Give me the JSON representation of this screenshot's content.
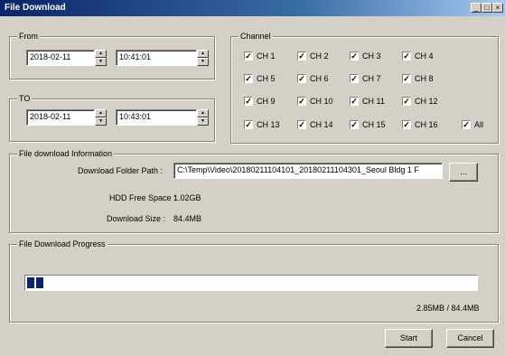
{
  "window": {
    "title": "File Download"
  },
  "from": {
    "label": "From",
    "date": "2018-02-11",
    "time": "10:41:01"
  },
  "to": {
    "label": "TO",
    "date": "2018-02-11",
    "time": "10:43:01"
  },
  "channel": {
    "label": "Channel",
    "items": [
      {
        "label": "CH 1",
        "checked": true
      },
      {
        "label": "CH 2",
        "checked": true
      },
      {
        "label": "CH 3",
        "checked": true
      },
      {
        "label": "CH 4",
        "checked": true
      },
      {
        "label": "CH 5",
        "checked": true
      },
      {
        "label": "CH 6",
        "checked": true
      },
      {
        "label": "CH 7",
        "checked": true
      },
      {
        "label": "CH 8",
        "checked": true
      },
      {
        "label": "CH 9",
        "checked": true
      },
      {
        "label": "CH 10",
        "checked": true
      },
      {
        "label": "CH 11",
        "checked": true
      },
      {
        "label": "CH 12",
        "checked": true
      },
      {
        "label": "CH 13",
        "checked": true
      },
      {
        "label": "CH 14",
        "checked": true
      },
      {
        "label": "CH 15",
        "checked": true
      },
      {
        "label": "CH 16",
        "checked": true
      }
    ],
    "all_label": "All"
  },
  "info": {
    "label": "File download Information",
    "folder_label": "Download Folder Path :",
    "folder_value": "C:\\Temp\\Video\\20180211104101_20180211104301_Seoul Bldg 1 F",
    "browse_label": "...",
    "hdd_label": "HDD Free Space :",
    "hdd_value": "1.02GB",
    "size_label": "Download Size :",
    "size_value": "84.4MB"
  },
  "progress": {
    "label": "File Download Progress",
    "text": "2.85MB / 84.4MB",
    "fraction": 0.034
  },
  "buttons": {
    "start": "Start",
    "cancel": "Cancel"
  }
}
